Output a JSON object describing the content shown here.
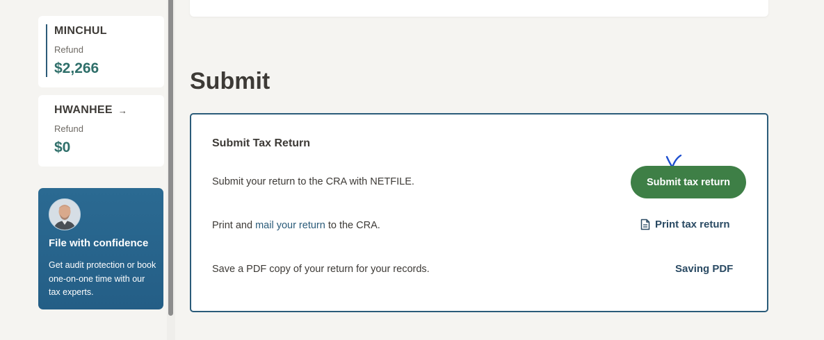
{
  "sidebar": {
    "people": [
      {
        "name": "MINCHUL",
        "label": "Refund",
        "amount": "$2,266"
      },
      {
        "name": "HWANHEE",
        "label": "Refund",
        "amount": "$0"
      }
    ],
    "promo": {
      "title": "File with confidence",
      "body": "Get audit protection or book one-on-one time with our tax experts."
    }
  },
  "main": {
    "section_title": "Submit",
    "panel": {
      "heading": "Submit Tax Return",
      "netfile_text": "Submit your return to the CRA with NETFILE.",
      "submit_button": "Submit tax return",
      "print_prefix": "Print and ",
      "print_link": "mail your return",
      "print_suffix": " to the CRA.",
      "print_button": "Print tax return",
      "pdf_text": "Save a PDF copy of your return for your records.",
      "pdf_button": "Saving PDF"
    }
  },
  "colors": {
    "accent_blue": "#2a5b79",
    "submit_green": "#3e7f46",
    "refund_teal": "#2f6f6a",
    "promo_blue": "#245e86"
  }
}
